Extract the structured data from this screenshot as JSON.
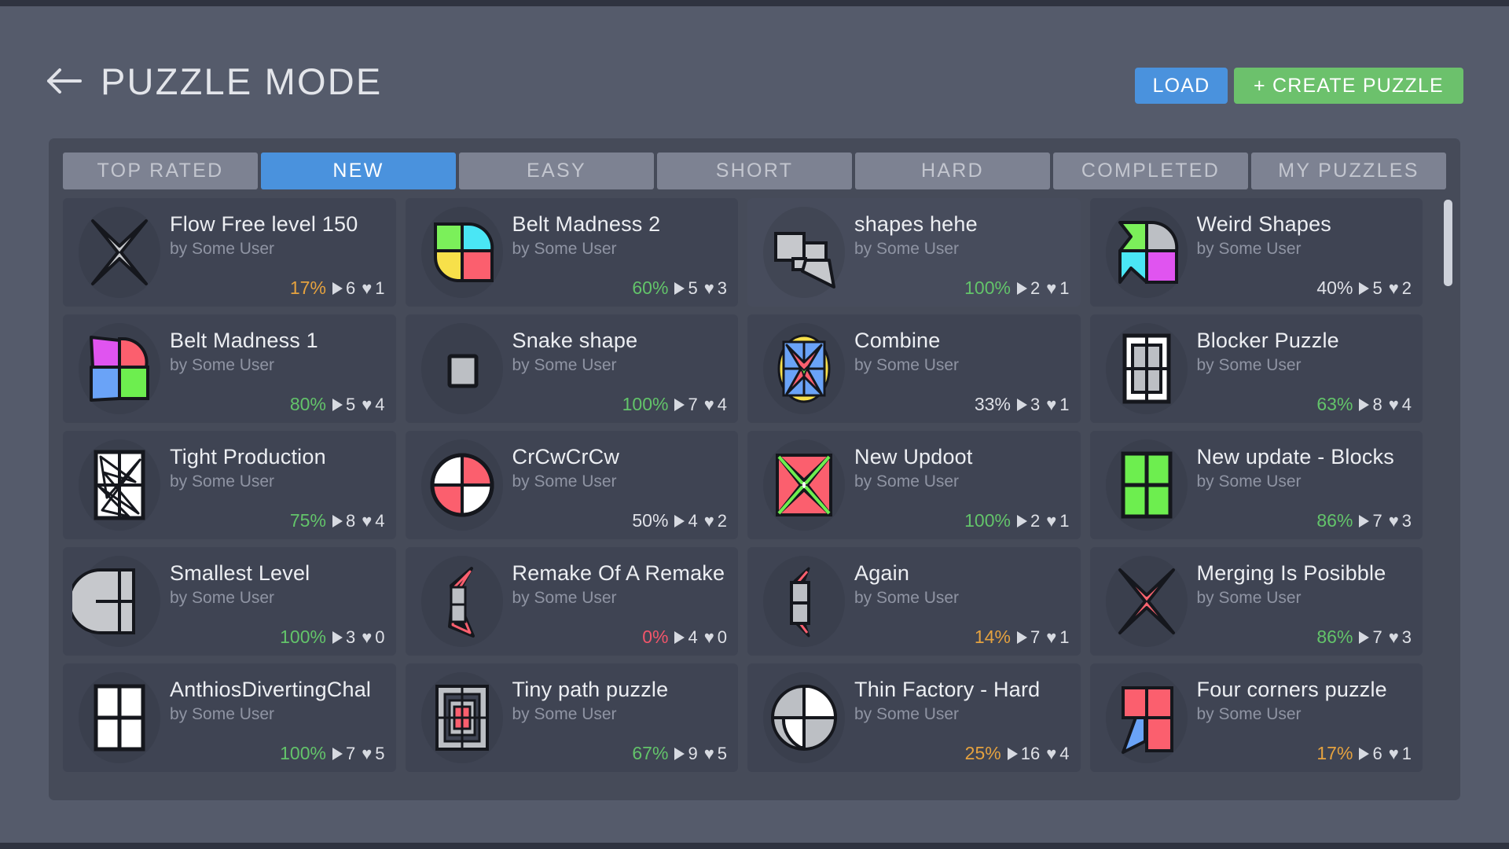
{
  "header": {
    "back_icon": "arrow-left-icon",
    "title": "PUZZLE MODE",
    "load_label": "LOAD",
    "create_label": "+ CREATE PUZZLE"
  },
  "theme": {
    "background": "#555b6b",
    "panel": "#464b59",
    "card": "#3f4453",
    "accent_blue": "#4a92dd",
    "accent_green": "#6cc16c",
    "pct_green": "#63c46a",
    "pct_orange": "#e5a23f",
    "pct_red": "#f2556a",
    "pct_white": "#dfe1e7"
  },
  "tabs": [
    {
      "label": "TOP RATED",
      "active": false
    },
    {
      "label": "NEW",
      "active": true
    },
    {
      "label": "EASY",
      "active": false
    },
    {
      "label": "SHORT",
      "active": false
    },
    {
      "label": "HARD",
      "active": false
    },
    {
      "label": "COMPLETED",
      "active": false
    },
    {
      "label": "MY PUZZLES",
      "active": false
    }
  ],
  "stats_icons": {
    "play": "play-icon",
    "heart": "heart-icon"
  },
  "cards": [
    {
      "title": "Flow Free level 150",
      "author": "by Some User",
      "percent": "17%",
      "pct_color": "orange",
      "plays": "6",
      "likes": "1",
      "thumb": "star-4-gray",
      "hovered": false
    },
    {
      "title": "Belt Madness 2",
      "author": "by Some User",
      "percent": "60%",
      "pct_color": "green",
      "plays": "5",
      "likes": "3",
      "thumb": "quad-green-cyan-yellow-red",
      "hovered": false
    },
    {
      "title": "shapes hehe",
      "author": "by Some User",
      "percent": "100%",
      "pct_color": "green",
      "plays": "2",
      "likes": "1",
      "thumb": "squares-and-wedge",
      "hovered": true
    },
    {
      "title": "Weird Shapes",
      "author": "by Some User",
      "percent": "40%",
      "pct_color": "white",
      "plays": "5",
      "likes": "2",
      "thumb": "quad-green-gray-cyan-magenta",
      "hovered": false
    },
    {
      "title": "Belt Madness 1",
      "author": "by Some User",
      "percent": "80%",
      "pct_color": "green",
      "plays": "5",
      "likes": "4",
      "thumb": "quad-magenta-red-blue-green",
      "hovered": false
    },
    {
      "title": "Snake shape",
      "author": "by Some User",
      "percent": "100%",
      "pct_color": "green",
      "plays": "7",
      "likes": "4",
      "thumb": "single-gray-square",
      "hovered": false
    },
    {
      "title": "Combine",
      "author": "by Some User",
      "percent": "33%",
      "pct_color": "white",
      "plays": "3",
      "likes": "1",
      "thumb": "yellow-blue-star",
      "hovered": false
    },
    {
      "title": "Blocker Puzzle",
      "author": "by Some User",
      "percent": "63%",
      "pct_color": "green",
      "plays": "8",
      "likes": "4",
      "thumb": "white-frame-grid",
      "hovered": false
    },
    {
      "title": "Tight Production",
      "author": "by Some User",
      "percent": "75%",
      "pct_color": "green",
      "plays": "8",
      "likes": "4",
      "thumb": "white-tangle-grid",
      "hovered": false
    },
    {
      "title": "CrCwCrCw",
      "author": "by Some User",
      "percent": "50%",
      "pct_color": "white",
      "plays": "4",
      "likes": "2",
      "thumb": "circle-white-red-quad",
      "hovered": false
    },
    {
      "title": "New Updoot",
      "author": "by Some User",
      "percent": "100%",
      "pct_color": "green",
      "plays": "2",
      "likes": "1",
      "thumb": "red-white-green-star",
      "hovered": false
    },
    {
      "title": "New update - Blocks",
      "author": "by Some User",
      "percent": "86%",
      "pct_color": "green",
      "plays": "7",
      "likes": "3",
      "thumb": "green-quad-blocks",
      "hovered": false
    },
    {
      "title": "Smallest Level",
      "author": "by Some User",
      "percent": "100%",
      "pct_color": "green",
      "plays": "3",
      "likes": "0",
      "thumb": "gray-rounded-quad",
      "hovered": false
    },
    {
      "title": "Remake Of A Remake",
      "author": "by Some User",
      "percent": "0%",
      "pct_color": "red",
      "plays": "4",
      "likes": "0",
      "thumb": "red-outline-sliver",
      "hovered": false
    },
    {
      "title": "Again",
      "author": "by Some User",
      "percent": "14%",
      "pct_color": "orange",
      "plays": "7",
      "likes": "1",
      "thumb": "gray-vertical-pair",
      "hovered": false
    },
    {
      "title": "Merging Is Posibble",
      "author": "by Some User",
      "percent": "86%",
      "pct_color": "green",
      "plays": "7",
      "likes": "3",
      "thumb": "star-4-red",
      "hovered": false
    },
    {
      "title": "AnthiosDivertingChal",
      "author": "by Some User",
      "percent": "100%",
      "pct_color": "green",
      "plays": "7",
      "likes": "5",
      "thumb": "white-quad-blocks",
      "hovered": false
    },
    {
      "title": "Tiny path puzzle",
      "author": "by Some User",
      "percent": "67%",
      "pct_color": "green",
      "plays": "9",
      "likes": "5",
      "thumb": "gray-spiral-red-center",
      "hovered": false
    },
    {
      "title": "Thin Factory - Hard",
      "author": "by Some User",
      "percent": "25%",
      "pct_color": "orange",
      "plays": "16",
      "likes": "4",
      "thumb": "gray-white-checker-circle",
      "hovered": false
    },
    {
      "title": "Four corners puzzle",
      "author": "by Some User",
      "percent": "17%",
      "pct_color": "orange",
      "plays": "6",
      "likes": "1",
      "thumb": "red-blocks-blue-wedge",
      "hovered": false
    }
  ]
}
